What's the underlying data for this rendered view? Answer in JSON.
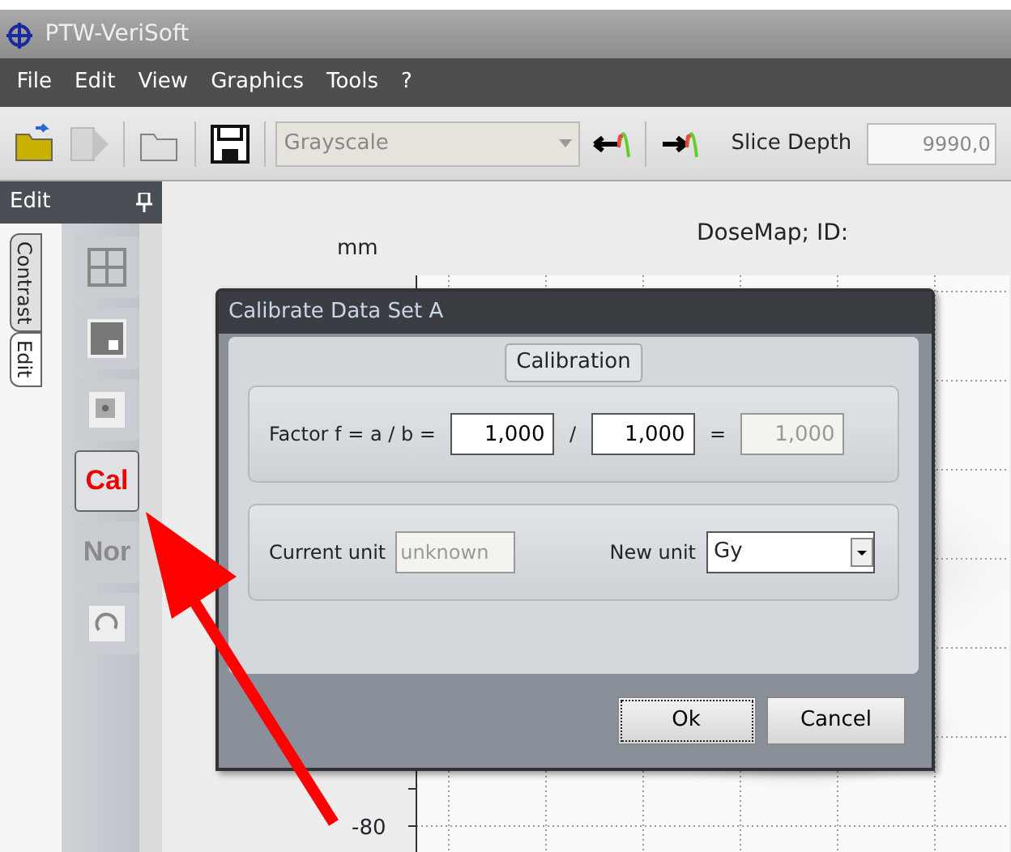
{
  "window": {
    "title": "PTW-VeriSoft"
  },
  "menu": [
    "File",
    "Edit",
    "View",
    "Graphics",
    "Tools",
    "?"
  ],
  "toolbar": {
    "buttons": [
      {
        "kind": "open",
        "disabled": false
      },
      {
        "kind": "play",
        "disabled": true
      },
      {
        "kind": "folder",
        "disabled": true
      },
      {
        "kind": "save",
        "disabled": false
      }
    ],
    "dropdown": {
      "value": "Grayscale",
      "disabled": true
    },
    "arrows": [
      {
        "kind": "left"
      },
      {
        "kind": "right"
      }
    ],
    "slice_depth": {
      "label": "Slice Depth",
      "value": "9990,0"
    }
  },
  "side_panel": {
    "title": "Edit",
    "tabs": [
      {
        "label": "Contrast",
        "selected": false
      },
      {
        "label": "Edit",
        "selected": true
      }
    ],
    "tools": [
      {
        "kind": "grid",
        "selected": false
      },
      {
        "kind": "square",
        "selected": false
      },
      {
        "kind": "target",
        "selected": false
      },
      {
        "kind": "text",
        "label": "Cal",
        "selected": true
      },
      {
        "kind": "text",
        "label": "Nor",
        "selected": false
      },
      {
        "kind": "refresh",
        "selected": false
      }
    ]
  },
  "plot": {
    "unit_label": "mm",
    "title": "DoseMap; ID:",
    "y_tick_label": "-80"
  },
  "dialog": {
    "title": "Calibrate Data Set A",
    "group_title": "Calibration",
    "factor": {
      "label": "Factor f = a / b =",
      "a": "1,000",
      "divide": "/",
      "b": "1,000",
      "equals": "=",
      "result": "1,000",
      "result_disabled": true
    },
    "units": {
      "current_label": "Current unit",
      "current": "unknown",
      "current_disabled": true,
      "new_label": "New unit",
      "new": "Gy"
    },
    "buttons": [
      {
        "label": "Ok",
        "focused": true
      },
      {
        "label": "Cancel",
        "focused": false
      }
    ]
  },
  "annotation": {
    "kind": "arrow"
  }
}
